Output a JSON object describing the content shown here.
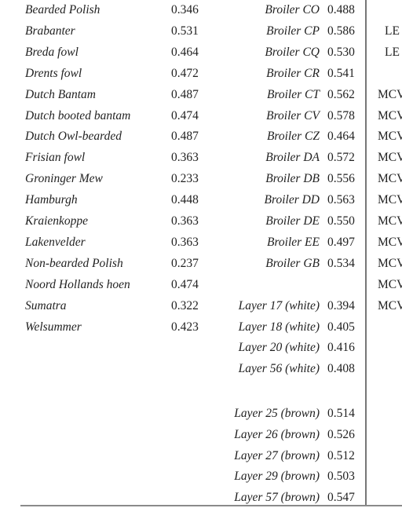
{
  "table": {
    "column_group_1": [
      {
        "name": "Bearded Polish",
        "value": "0.346"
      },
      {
        "name": "Brabanter",
        "value": "0.531"
      },
      {
        "name": "Breda fowl",
        "value": "0.464"
      },
      {
        "name": "Drents fowl",
        "value": "0.472"
      },
      {
        "name": "Dutch Bantam",
        "value": "0.487"
      },
      {
        "name": "Dutch booted bantam",
        "value": "0.474"
      },
      {
        "name": "Dutch Owl-bearded",
        "value": "0.487"
      },
      {
        "name": "Frisian fowl",
        "value": "0.363"
      },
      {
        "name": "Groninger Mew",
        "value": "0.233"
      },
      {
        "name": "Hamburgh",
        "value": "0.448"
      },
      {
        "name": "Kraienkoppe",
        "value": "0.363"
      },
      {
        "name": "Lakenvelder",
        "value": "0.363"
      },
      {
        "name": "Non-bearded Polish",
        "value": "0.237"
      },
      {
        "name": "Noord Hollands hoen",
        "value": "0.474"
      },
      {
        "name": "Sumatra",
        "value": "0.322"
      },
      {
        "name": "Welsummer",
        "value": "0.423"
      }
    ],
    "column_group_2_broilers": [
      {
        "name": "Broiler CO",
        "value": "0.488"
      },
      {
        "name": "Broiler CP",
        "value": "0.586"
      },
      {
        "name": "Broiler CQ",
        "value": "0.530"
      },
      {
        "name": "Broiler CR",
        "value": "0.541"
      },
      {
        "name": "Broiler CT",
        "value": "0.562"
      },
      {
        "name": "Broiler CV",
        "value": "0.578"
      },
      {
        "name": "Broiler CZ",
        "value": "0.464"
      },
      {
        "name": "Broiler DA",
        "value": "0.572"
      },
      {
        "name": "Broiler DB",
        "value": "0.556"
      },
      {
        "name": "Broiler DD",
        "value": "0.563"
      },
      {
        "name": "Broiler DE",
        "value": "0.550"
      },
      {
        "name": "Broiler EE",
        "value": "0.497"
      },
      {
        "name": "Broiler GB",
        "value": "0.534"
      }
    ],
    "column_group_2_white_layers": [
      {
        "name": "Layer 17 (white)",
        "value": "0.394"
      },
      {
        "name": "Layer 18 (white)",
        "value": "0.405"
      },
      {
        "name": "Layer 20 (white)",
        "value": "0.416"
      },
      {
        "name": "Layer 56 (white)",
        "value": "0.408"
      }
    ],
    "column_group_2_brown_layers": [
      {
        "name": "Layer 25 (brown)",
        "value": "0.514"
      },
      {
        "name": "Layer 26 (brown)",
        "value": "0.526"
      },
      {
        "name": "Layer 27 (brown)",
        "value": "0.512"
      },
      {
        "name": "Layer 29 (brown)",
        "value": "0.503"
      },
      {
        "name": "Layer 57 (brown)",
        "value": "0.547"
      }
    ],
    "column_group_3_partial": [
      "",
      "LE",
      "LE",
      "",
      "MCV",
      "MCV",
      "MCV",
      "MCV",
      "MCV",
      "MCV",
      "MCV",
      "MCV",
      "MCV",
      "MCV",
      "MCV"
    ]
  }
}
